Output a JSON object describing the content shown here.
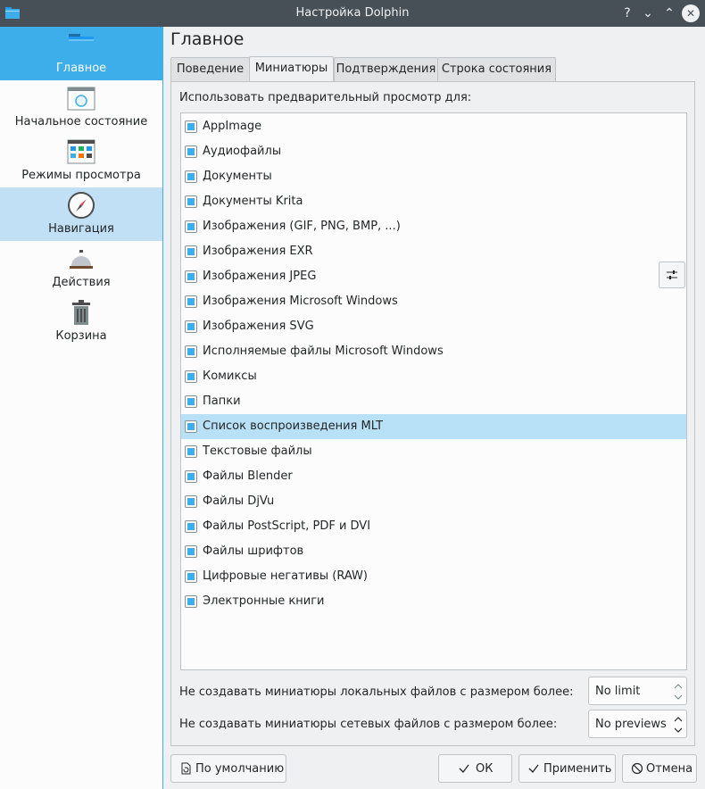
{
  "window": {
    "title": "Настройка Dolphin",
    "help_glyph": "?",
    "minimize_glyph": "⌄",
    "maximize_glyph": "⌃",
    "close_glyph": "✕"
  },
  "sidebar": {
    "items": [
      {
        "label": "Главное",
        "icon": "folder-icon",
        "state": "active"
      },
      {
        "label": "Начальное состояние",
        "icon": "startup-window-icon",
        "state": "normal"
      },
      {
        "label": "Режимы просмотра",
        "icon": "view-modes-icon",
        "state": "normal"
      },
      {
        "label": "Навигация",
        "icon": "compass-icon",
        "state": "hover"
      },
      {
        "label": "Действия",
        "icon": "service-bell-icon",
        "state": "normal"
      },
      {
        "label": "Корзина",
        "icon": "trash-icon",
        "state": "normal"
      }
    ]
  },
  "main": {
    "title": "Главное",
    "tabs": [
      {
        "label": "Поведение",
        "active": false
      },
      {
        "label": "Миниатюры",
        "active": true
      },
      {
        "label": "Подтверждения",
        "active": false
      },
      {
        "label": "Строка состояния",
        "active": false
      }
    ],
    "preview_caption": "Использовать предварительный просмотр для:",
    "preview_items": [
      {
        "label": "AppImage",
        "checked": true
      },
      {
        "label": "Аудиофайлы",
        "checked": true
      },
      {
        "label": "Документы",
        "checked": true
      },
      {
        "label": "Документы Krita",
        "checked": true
      },
      {
        "label": "Изображения (GIF, PNG, BMP, ...)",
        "checked": true
      },
      {
        "label": "Изображения EXR",
        "checked": true
      },
      {
        "label": "Изображения JPEG",
        "checked": true
      },
      {
        "label": "Изображения Microsoft Windows",
        "checked": true
      },
      {
        "label": "Изображения SVG",
        "checked": true
      },
      {
        "label": "Исполняемые файлы Microsoft Windows",
        "checked": true
      },
      {
        "label": "Комиксы",
        "checked": true
      },
      {
        "label": "Папки",
        "checked": true
      },
      {
        "label": "Список воспроизведения MLT",
        "checked": true,
        "selected": true
      },
      {
        "label": "Текстовые файлы",
        "checked": true
      },
      {
        "label": "Файлы Blender",
        "checked": true
      },
      {
        "label": "Файлы DjVu",
        "checked": true
      },
      {
        "label": "Файлы PostScript, PDF и DVI",
        "checked": true
      },
      {
        "label": "Файлы шрифтов",
        "checked": true
      },
      {
        "label": "Цифровые негативы (RAW)",
        "checked": true
      },
      {
        "label": "Электронные книги",
        "checked": true
      }
    ],
    "local_size_label": "Не создавать миниатюры локальных файлов с размером более:",
    "local_size_value": "No limit",
    "remote_size_label": "Не создавать миниатюры сетевых файлов с размером более:",
    "remote_size_value": "No previews"
  },
  "buttons": {
    "defaults": "По умолчанию",
    "ok": "ОК",
    "apply": "Применить",
    "cancel": "Отмена"
  },
  "colors": {
    "accent": "#3daee9",
    "titlebar": "#475057",
    "selection": "#b8e0f7",
    "hover": "#c2e0f5"
  }
}
